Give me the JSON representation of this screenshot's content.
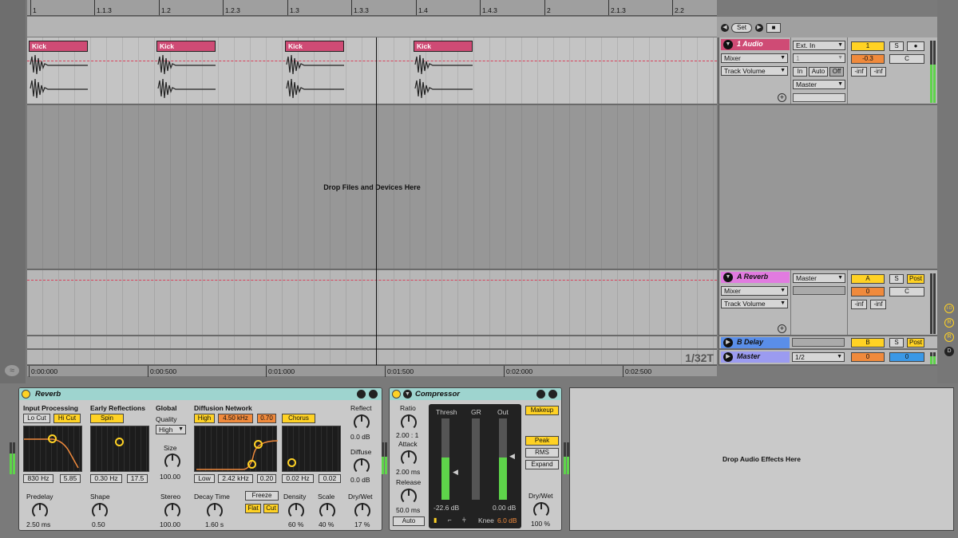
{
  "ruler": {
    "ticks": [
      "1",
      "1.1.3",
      "1.2",
      "1.2.3",
      "1.3",
      "1.3.3",
      "1.4",
      "1.4.3",
      "2",
      "2.1.3",
      "2.2"
    ]
  },
  "scene": {
    "set_label": "Set"
  },
  "tracks": {
    "audio": {
      "name": "1 Audio",
      "color": "#cf4b75",
      "clips": [
        "Kick",
        "Kick",
        "Kick",
        "Kick"
      ],
      "input_type": "Ext. In",
      "input_channel": "1",
      "view": "Mixer",
      "automation": "Track Volume",
      "monitor": [
        "In",
        "Auto",
        "Off"
      ],
      "output": "Master",
      "number": "1",
      "solo": "S",
      "volume": "-0.3",
      "pan": "C",
      "send_a": "-inf",
      "send_b": "-inf"
    },
    "reverb": {
      "name": "A Reverb",
      "color": "#e17be0",
      "output": "Master",
      "view": "Mixer",
      "automation": "Track Volume",
      "letter": "A",
      "solo": "S",
      "post": "Post",
      "volume": "0",
      "pan": "C",
      "send_a": "-inf",
      "send_b": "-inf"
    },
    "delay": {
      "name": "B Delay",
      "color": "#5a8ee8",
      "letter": "B",
      "solo": "S",
      "post": "Post"
    },
    "master": {
      "name": "Master",
      "color": "#9b9bf0",
      "cue": "1/2",
      "volume": "0",
      "pan": "0"
    }
  },
  "drop_files_text": "Drop Files and Devices Here",
  "quantize": "1/32T",
  "time_ruler": [
    "0:00:000",
    "0:00:500",
    "0:01:000",
    "0:01:500",
    "0:02:000",
    "0:02:500"
  ],
  "side_buttons": [
    "I·O",
    "R",
    "R",
    "D"
  ],
  "reverb_device": {
    "title": "Reverb",
    "sections": [
      "Input Processing",
      "Early Reflections",
      "Global",
      "Diffusion Network"
    ],
    "lo_cut": "Lo Cut",
    "hi_cut": "Hi Cut",
    "spin": "Spin",
    "quality_label": "Quality",
    "quality": "High",
    "high": "High",
    "high_freq": "4.50 kHz",
    "high_val": "0.70",
    "chorus": "Chorus",
    "reflect_label": "Reflect",
    "reflect_val": "0.0 dB",
    "size_label": "Size",
    "size_val": "100.00",
    "diffuse_label": "Diffuse",
    "diffuse_val": "0.0 dB",
    "in_freq": "830 Hz",
    "in_q": "5.85",
    "er_freq": "0.30 Hz",
    "er_amt": "17.5",
    "low": "Low",
    "low_freq": "2.42 kHz",
    "low_val": "0.20",
    "chorus_rate": "0.02 Hz",
    "chorus_amt": "0.02",
    "predelay_label": "Predelay",
    "predelay_val": "2.50 ms",
    "shape_label": "Shape",
    "shape_val": "0.50",
    "stereo_label": "Stereo",
    "stereo_val": "100.00",
    "decay_label": "Decay Time",
    "decay_val": "1.60 s",
    "freeze": "Freeze",
    "flat": "Flat",
    "cut": "Cut",
    "density_label": "Density",
    "density_val": "60 %",
    "scale_label": "Scale",
    "scale_val": "40 %",
    "drywet_label": "Dry/Wet",
    "drywet_val": "17 %"
  },
  "compressor_device": {
    "title": "Compressor",
    "ratio_label": "Ratio",
    "ratio_val": "2.00 : 1",
    "attack_label": "Attack",
    "attack_val": "2.00 ms",
    "release_label": "Release",
    "release_val": "50.0 ms",
    "auto": "Auto",
    "thresh_label": "Thresh",
    "gr_label": "GR",
    "out_label": "Out",
    "thresh_val": "-22.6 dB",
    "out_val": "0.00 dB",
    "knee_label": "Knee",
    "knee_val": "6.0 dB",
    "makeup": "Makeup",
    "peak": "Peak",
    "rms": "RMS",
    "expand": "Expand",
    "drywet_label": "Dry/Wet",
    "drywet_val": "100 %"
  },
  "drop_effects_text": "Drop Audio Effects Here"
}
